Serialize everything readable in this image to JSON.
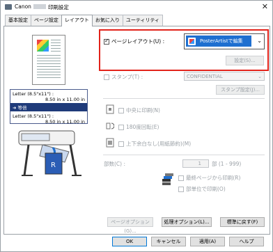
{
  "window": {
    "title_prefix": "Canon",
    "title_suffix": "印刷設定",
    "close_label": "✕"
  },
  "tabs": [
    {
      "label": "基本設定"
    },
    {
      "label": "ページ設定"
    },
    {
      "label": "レイアウト",
      "active": true
    },
    {
      "label": "お気に入り"
    },
    {
      "label": "ユーティリティ"
    }
  ],
  "preview": {
    "paper_from": "Letter (8.5\"x11\") :",
    "paper_from_dims": "8.50 in x 11.00 in",
    "scale_label": "等倍",
    "paper_to": "Letter (8.5\"x11\") :",
    "paper_to_dims": "8.50 in x 11.00 in"
  },
  "page_layout": {
    "label": "ページレイアウト(U) :",
    "checked": true,
    "selected": "PosterArtistで編集",
    "settings_button": "設定(S)..."
  },
  "stamp": {
    "label": "スタンプ(T) :",
    "checked": false,
    "selected": "CONFIDENTIAL",
    "settings_button": "スタンプ設定(J)..."
  },
  "options": {
    "center_print": "中央に印刷(N)",
    "rotate_180": "180度回転(E)",
    "no_margin": "上下余白なし(用紙節約)(M)"
  },
  "copies": {
    "label": "部数(C) :",
    "value": "1",
    "range": "部 (1 - 999)",
    "reverse_order": "最終ページから印刷(R)",
    "collate": "部単位で印刷(O)"
  },
  "action_buttons": {
    "page_options": "ページオプション(G)...",
    "process_options": "処理オプション(L)...",
    "restore_defaults": "標準に戻す(F)"
  },
  "dialog_buttons": {
    "ok": "OK",
    "cancel": "キャンセル",
    "apply": "適用(A)",
    "help": "ヘルプ"
  },
  "colors": {
    "accent": "#1e6fd0",
    "highlight_frame": "#e2231a",
    "preview_band": "#1f3b7a"
  }
}
